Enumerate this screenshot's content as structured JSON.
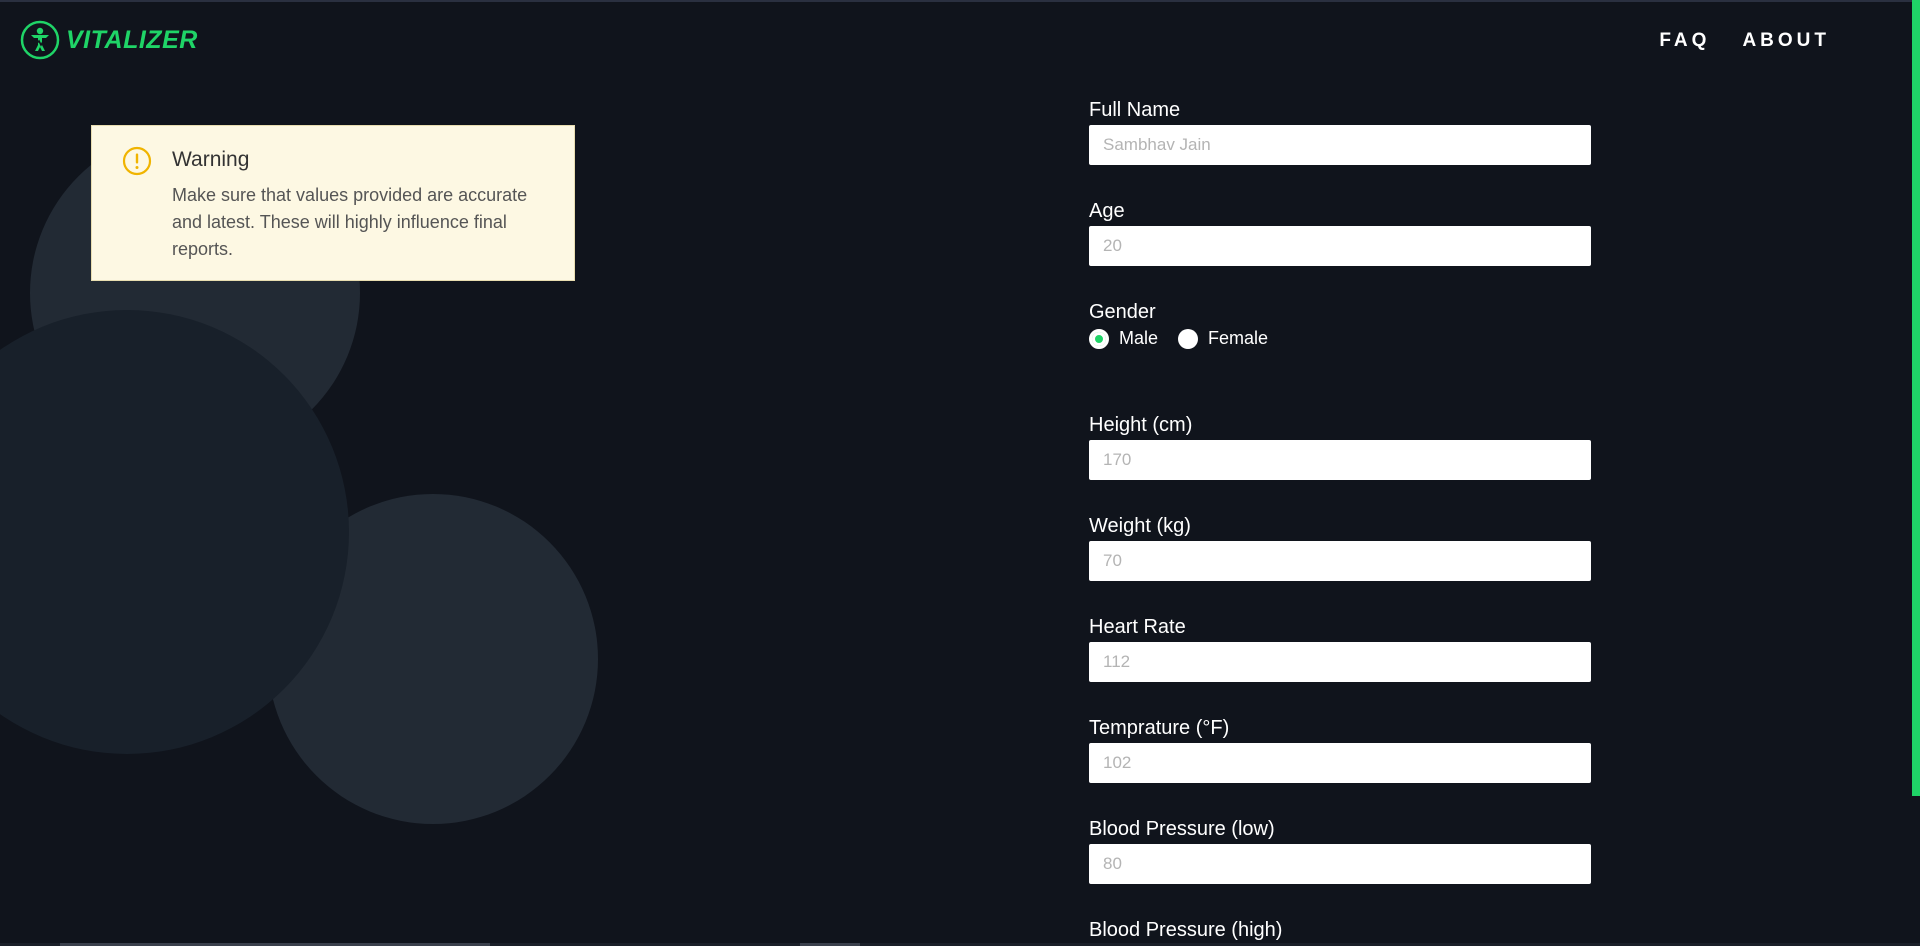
{
  "header": {
    "brand": "VITALIZER",
    "nav": [
      "FAQ",
      "ABOUT"
    ]
  },
  "colors": {
    "accent": "#1fd467",
    "background": "#10141c",
    "warning_bg": "#fdf8e3",
    "warning_icon": "#f0b400"
  },
  "warning": {
    "icon": "exclamation-circle-icon",
    "title": "Warning",
    "text": "Make sure that values provided are accurate and latest. These will highly influence final reports."
  },
  "form": {
    "full_name": {
      "label": "Full Name",
      "placeholder": "Sambhav Jain"
    },
    "age": {
      "label": "Age",
      "placeholder": "20"
    },
    "gender": {
      "label": "Gender",
      "options": [
        "Male",
        "Female"
      ],
      "selected": "Male"
    },
    "height": {
      "label": "Height (cm)",
      "placeholder": "170"
    },
    "weight": {
      "label": "Weight (kg)",
      "placeholder": "70"
    },
    "heart_rate": {
      "label": "Heart Rate",
      "placeholder": "112"
    },
    "temperature": {
      "label": "Temprature (°F)",
      "placeholder": "102"
    },
    "bp_low": {
      "label": "Blood Pressure (low)",
      "placeholder": "80"
    },
    "bp_high": {
      "label": "Blood Pressure (high)"
    }
  }
}
